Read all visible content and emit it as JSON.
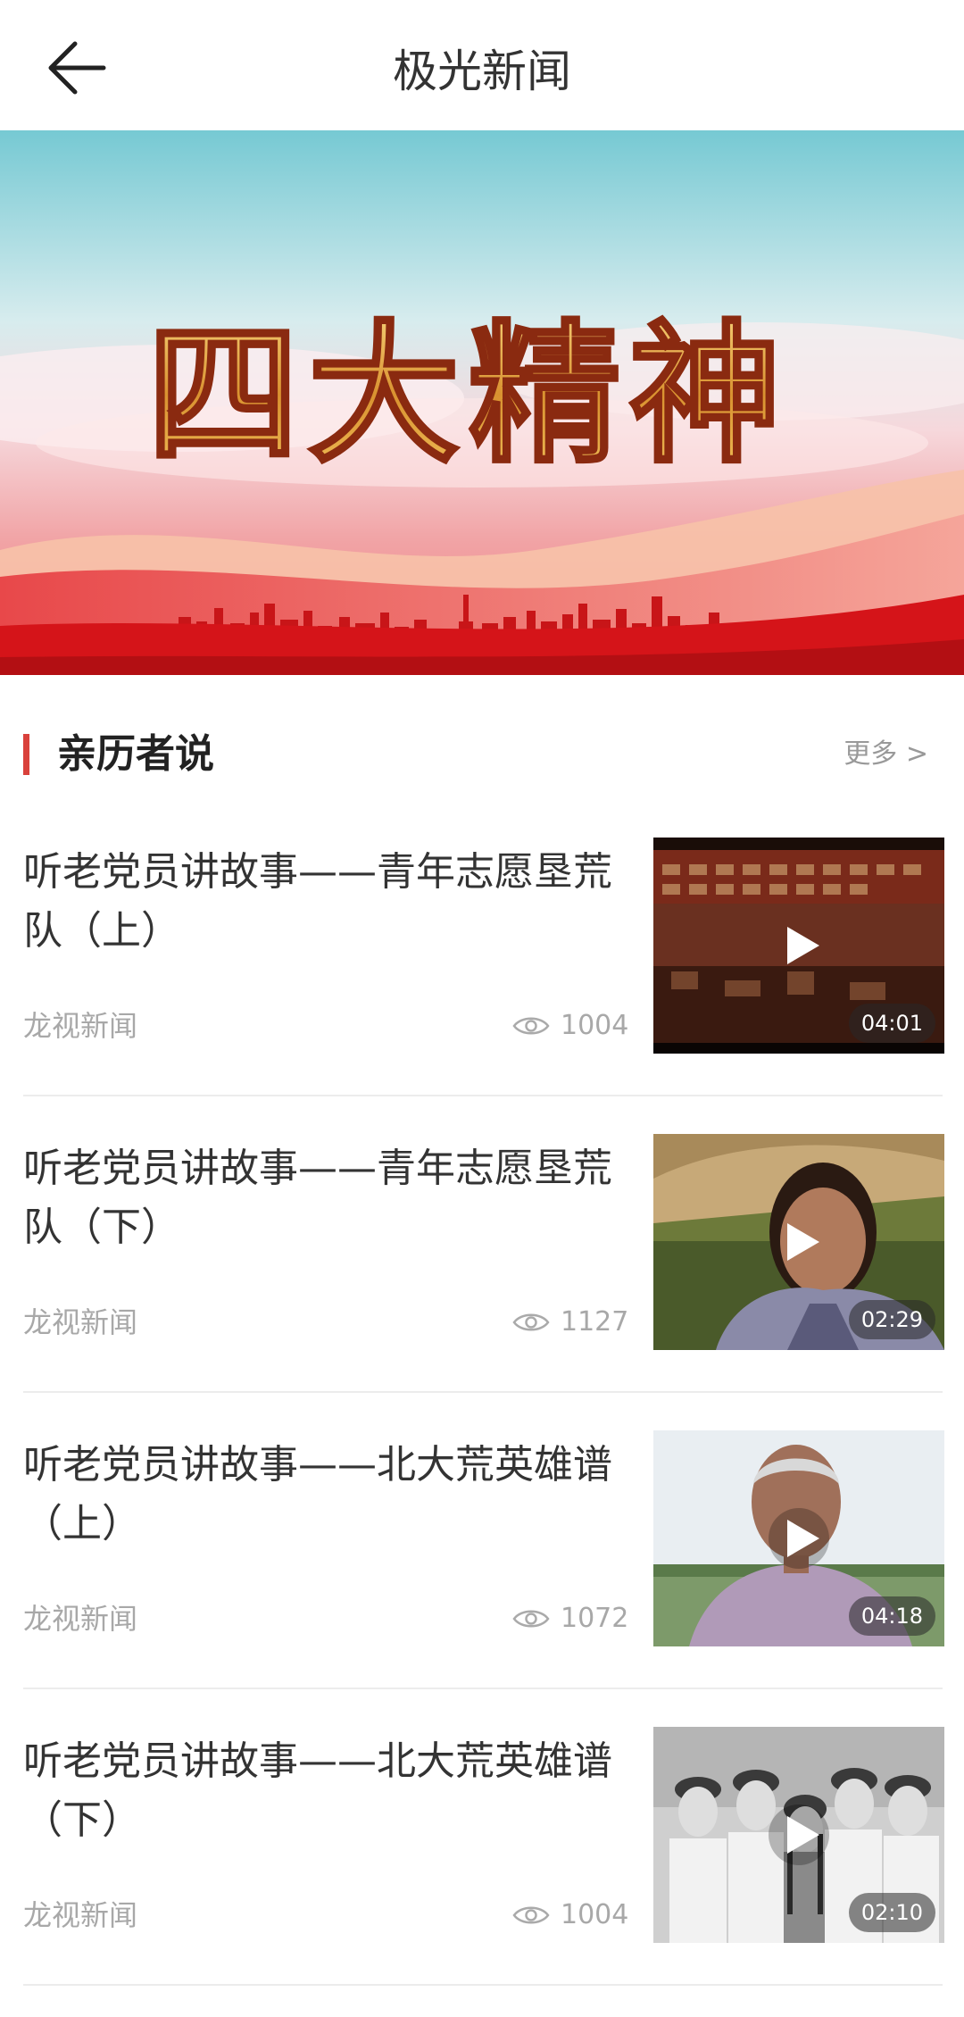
{
  "header": {
    "title": "极光新闻",
    "back_icon": "arrow-left-icon"
  },
  "banner": {
    "headline": "四大精神",
    "colors": {
      "sky_top": "#7fcfd8",
      "sky_mid": "#f3d6da",
      "red": "#d8161c",
      "gold": "#e6a73a"
    }
  },
  "section": {
    "title": "亲历者说",
    "more_label": "更多 >",
    "accent": "#d9413b"
  },
  "items": [
    {
      "title": "听老党员讲故事——青年志愿垦荒队（上）",
      "source": "龙视新闻",
      "views": "1004",
      "duration": "04:01"
    },
    {
      "title": "听老党员讲故事——青年志愿垦荒队（下）",
      "source": "龙视新闻",
      "views": "1127",
      "duration": "02:29"
    },
    {
      "title": "听老党员讲故事——北大荒英雄谱（上）",
      "source": "龙视新闻",
      "views": "1072",
      "duration": "04:18"
    },
    {
      "title": "听老党员讲故事——北大荒英雄谱（下）",
      "source": "龙视新闻",
      "views": "1004",
      "duration": "02:10"
    }
  ]
}
